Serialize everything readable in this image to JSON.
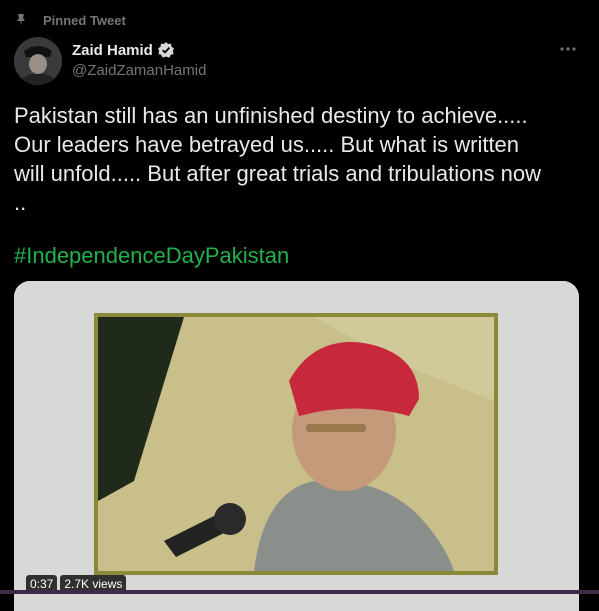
{
  "pinned": {
    "label": "Pinned Tweet",
    "icon": "pin-icon"
  },
  "author": {
    "display_name": "Zaid Hamid",
    "handle": "@ZaidZamanHamid",
    "verified_icon": "verified-badge-icon"
  },
  "tweet": {
    "text": "Pakistan still has an unfinished destiny to achieve.....\nOur leaders have betrayed us..... But what is written\nwill unfold..... But after great trials and tribulations now\n..",
    "hashtag": "#IndependenceDayPakistan"
  },
  "video": {
    "duration": "0:37",
    "views": "2.7K views"
  },
  "colors": {
    "background": "#000000",
    "text": "#e7e9ea",
    "muted": "#71767b",
    "hashtag": "#22b14c",
    "verified": "#d9d9d9"
  }
}
